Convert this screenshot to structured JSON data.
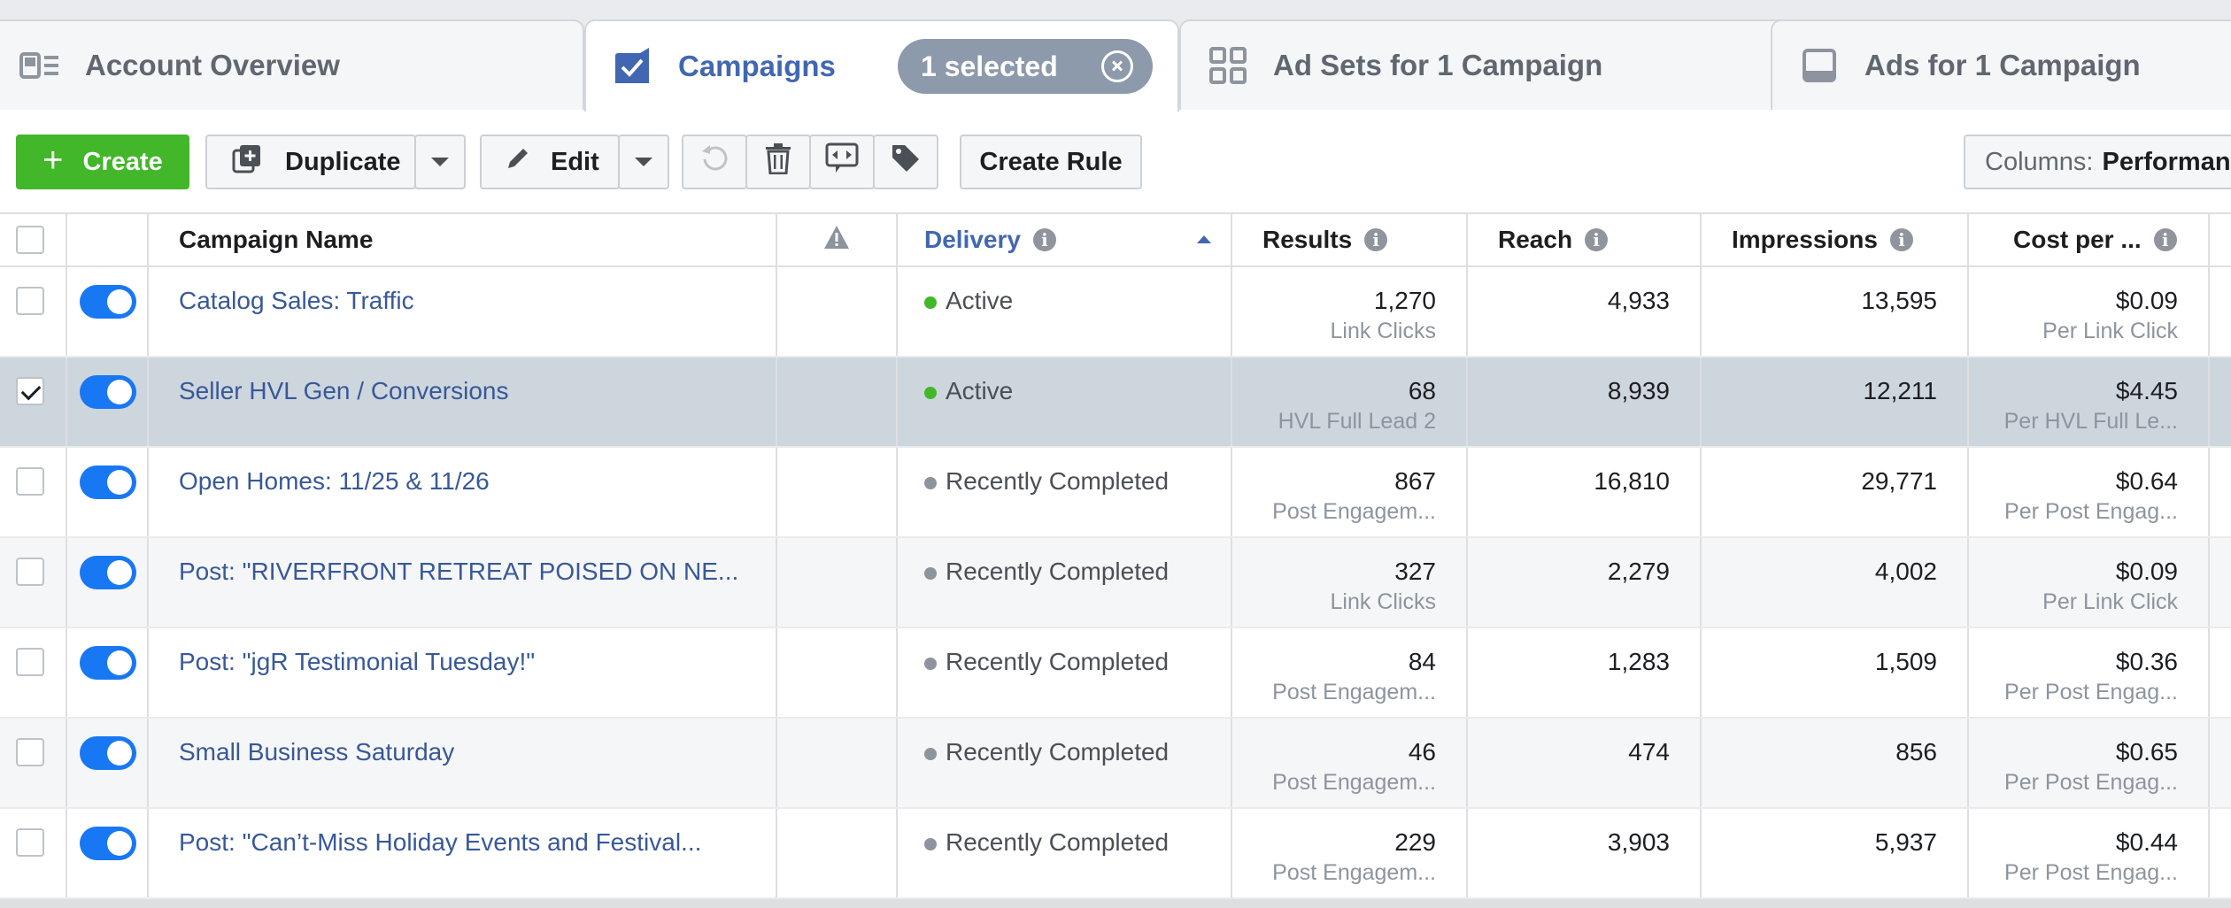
{
  "tabs": {
    "account_overview": "Account Overview",
    "campaigns": "Campaigns",
    "selected_pill": "1 selected",
    "ad_sets": "Ad Sets for 1 Campaign",
    "ads": "Ads for 1 Campaign"
  },
  "toolbar": {
    "create_label": "Create",
    "duplicate_label": "Duplicate",
    "edit_label": "Edit",
    "create_rule_label": "Create Rule",
    "columns_label": "Columns:",
    "columns_value": "Performanc"
  },
  "table": {
    "headers": {
      "campaign_name": "Campaign Name",
      "delivery": "Delivery",
      "results": "Results",
      "reach": "Reach",
      "impressions": "Impressions",
      "cost_per": "Cost per ..."
    },
    "rows": [
      {
        "name": "Catalog Sales: Traffic",
        "delivery": "Active",
        "results": "1,270",
        "results_type": "Link Clicks",
        "reach": "4,933",
        "impressions": "13,595",
        "cost": "$0.09",
        "cost_type": "Per Link Click",
        "checked": false
      },
      {
        "name": "Seller HVL Gen / Conversions",
        "delivery": "Active",
        "results": "68",
        "results_type": "HVL Full Lead 2",
        "reach": "8,939",
        "impressions": "12,211",
        "cost": "$4.45",
        "cost_type": "Per HVL Full Le...",
        "checked": true
      },
      {
        "name": "Open Homes: 11/25 & 11/26",
        "delivery": "Recently Completed",
        "results": "867",
        "results_type": "Post Engagem...",
        "reach": "16,810",
        "impressions": "29,771",
        "cost": "$0.64",
        "cost_type": "Per Post Engag...",
        "checked": false
      },
      {
        "name": "Post: \"RIVERFRONT RETREAT POISED ON NE...",
        "delivery": "Recently Completed",
        "results": "327",
        "results_type": "Link Clicks",
        "reach": "2,279",
        "impressions": "4,002",
        "cost": "$0.09",
        "cost_type": "Per Link Click",
        "checked": false
      },
      {
        "name": "Post: \"jgR Testimonial Tuesday!\"",
        "delivery": "Recently Completed",
        "results": "84",
        "results_type": "Post Engagem...",
        "reach": "1,283",
        "impressions": "1,509",
        "cost": "$0.36",
        "cost_type": "Per Post Engag...",
        "checked": false
      },
      {
        "name": "Small Business Saturday",
        "delivery": "Recently Completed",
        "results": "46",
        "results_type": "Post Engagem...",
        "reach": "474",
        "impressions": "856",
        "cost": "$0.65",
        "cost_type": "Per Post Engag...",
        "checked": false
      },
      {
        "name": "Post: \"Can’t-Miss Holiday Events and Festival...",
        "delivery": "Recently Completed",
        "results": "229",
        "results_type": "Post Engagem...",
        "reach": "3,903",
        "impressions": "5,937",
        "cost": "$0.44",
        "cost_type": "Per Post Engag...",
        "checked": false
      }
    ]
  },
  "colors": {
    "brand_blue": "#4267b2",
    "create_green": "#42b72a",
    "toggle_blue": "#1877f2",
    "selected_row": "#cdd5dd"
  }
}
